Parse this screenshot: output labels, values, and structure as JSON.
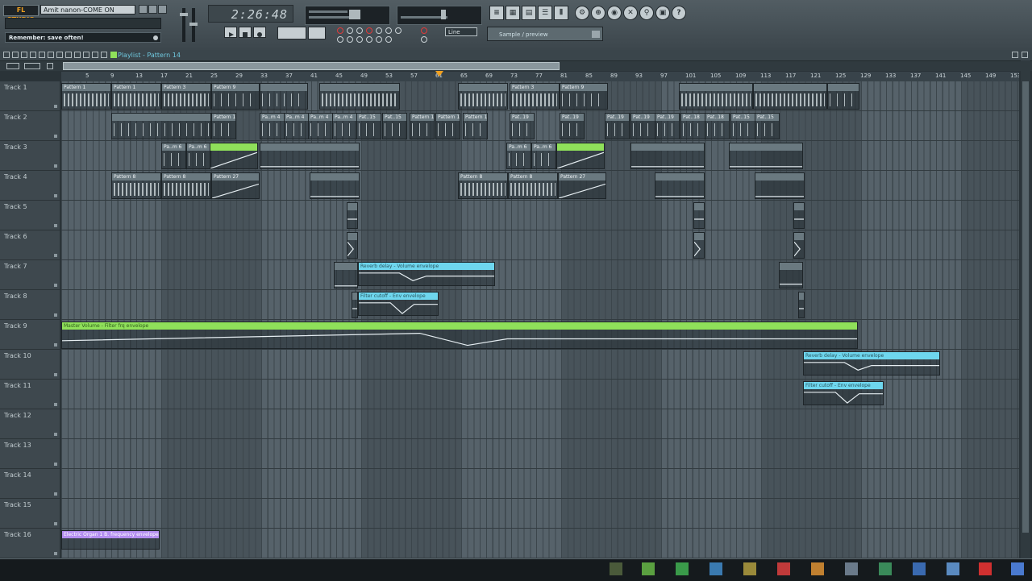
{
  "app": {
    "logo": "FL STUDIO",
    "song_title": "Amit nanon-COME ON",
    "hint": "Remember: save often!",
    "time": "2:26:48",
    "mode": "Line",
    "pattern_selector": "Sample / preview"
  },
  "playlist": {
    "title": "Playlist - Pattern 14",
    "ruler": [
      "5",
      "9",
      "13",
      "17",
      "21",
      "25",
      "29",
      "33",
      "37",
      "41",
      "45",
      "49",
      "53",
      "57",
      "61",
      "65",
      "69",
      "73",
      "77",
      "81",
      "85",
      "89",
      "93",
      "97",
      "101",
      "105",
      "109",
      "113",
      "117",
      "121",
      "125",
      "129",
      "133",
      "137",
      "141",
      "145",
      "149",
      "153"
    ],
    "tracks": [
      "Track 1",
      "Track 2",
      "Track 3",
      "Track 4",
      "Track 5",
      "Track 6",
      "Track 7",
      "Track 8",
      "Track 9",
      "Track 10",
      "Track 11",
      "Track 12",
      "Track 13",
      "Track 14",
      "Track 15",
      "Track 16"
    ]
  },
  "clips": {
    "t1": [
      "Pattern 1",
      "Pattern 1",
      "Pattern 3",
      "Pattern 9",
      "Pattern 3",
      "Pattern 9"
    ],
    "t2": [
      "Pattern 10",
      "Pa..m 4",
      "Pa..m 4",
      "Pa..m 4",
      "Pa..m 4",
      "Pat..15",
      "Pat..15",
      "Pattern 1",
      "Pattern 1",
      "Pattern 10",
      "Pat..19",
      "Pat..19",
      "Pat..19",
      "Pat..19",
      "Pat..19",
      "Pat..18",
      "Pat..18",
      "Pat..15",
      "Pat..15"
    ],
    "t3": [
      "Pa..m 6",
      "Pa..m 6",
      "Pa..m 6",
      "Pa..m 6"
    ],
    "t4": [
      "Pattern 8",
      "Pattern 8",
      "Pattern 27",
      "Pattern 8",
      "Pattern 8",
      "Pattern 27"
    ],
    "t7": "Reverb delay - Volume envelope",
    "t8": "Filter cutoff - Env envelope",
    "t9": "Master Volume - Filter frq envelope",
    "t10": "Reverb delay - Volume envelope",
    "t11": "Filter cutoff - Env envelope",
    "t16": "Electric Organ 1 B. frequency envelope"
  },
  "colors": {
    "accent": "#f0a020",
    "clip_default": "#6a7980",
    "clip_cyan": "#6ed6ee",
    "clip_green": "#8fe05a",
    "clip_violet": "#b48ef0"
  },
  "icons": [
    "search-icon",
    "gear-icon",
    "mixer-icon",
    "piano-roll-icon",
    "browser-icon",
    "step-sequencer-icon",
    "playlist-icon",
    "play-icon",
    "stop-icon",
    "record-icon"
  ]
}
